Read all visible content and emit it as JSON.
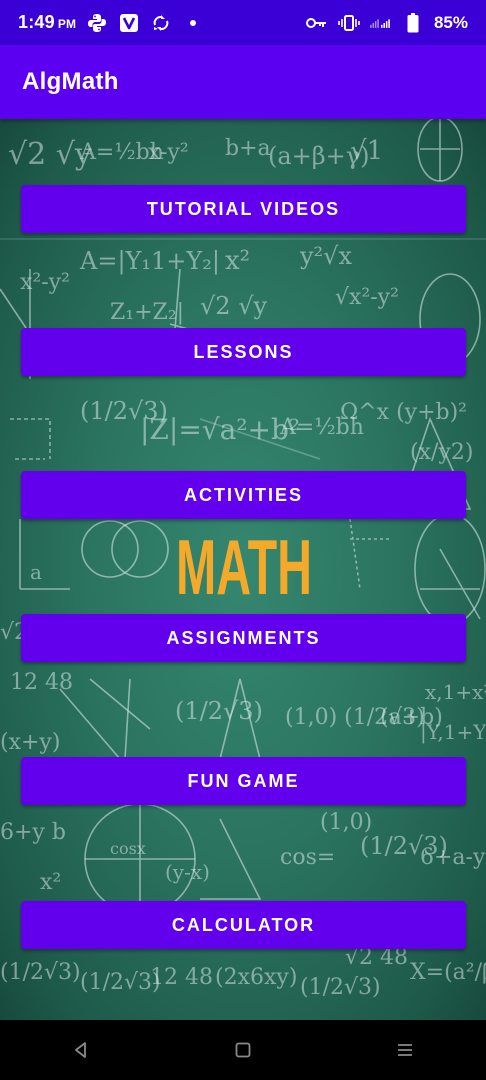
{
  "status_bar": {
    "time": "1:49",
    "ampm": "PM",
    "battery": "85%",
    "icons": [
      "python-icon",
      "v-app-icon",
      "sync-icon",
      "dot-icon",
      "key-icon",
      "vibrate-icon",
      "signal-icon",
      "battery-icon"
    ]
  },
  "app_bar": {
    "title": "AlgMath"
  },
  "background": {
    "logo_text": "MATH"
  },
  "menu": {
    "buttons": [
      {
        "label": "TUTORIAL VIDEOS"
      },
      {
        "label": "LESSONS"
      },
      {
        "label": "ACTIVITIES"
      },
      {
        "label": "ASSIGNMENTS"
      },
      {
        "label": "FUN GAME"
      },
      {
        "label": "CALCULATOR"
      }
    ]
  },
  "nav_bar": {
    "icons": [
      "back-icon",
      "home-icon",
      "recents-icon"
    ]
  },
  "colors": {
    "status_bar": "#3a00d6",
    "app_bar": "#5b00f0",
    "button": "#6200ee",
    "chalkboard": "#2b7460",
    "logo": "#f4a92b"
  }
}
